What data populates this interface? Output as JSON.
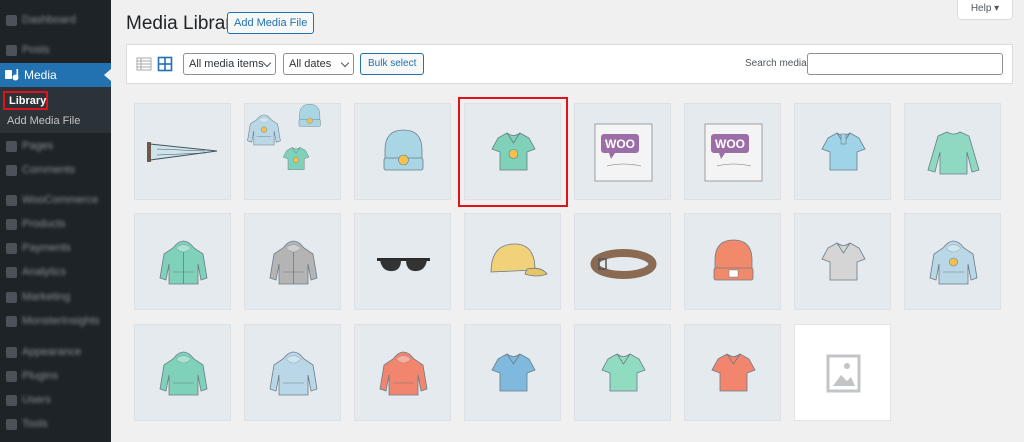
{
  "sidebar": {
    "items": [
      {
        "label": "Dashboard",
        "icon": "dashboard-icon"
      },
      {
        "label": "Posts",
        "icon": "posts-icon"
      },
      {
        "label": "Media",
        "icon": "media-icon",
        "active": true
      },
      {
        "label": "Pages",
        "icon": "pages-icon"
      },
      {
        "label": "Comments",
        "icon": "comments-icon"
      },
      {
        "label": "WooCommerce",
        "icon": "woocommerce-icon"
      },
      {
        "label": "Products",
        "icon": "products-icon"
      },
      {
        "label": "Payments",
        "icon": "payments-icon"
      },
      {
        "label": "Analytics",
        "icon": "analytics-icon"
      },
      {
        "label": "Marketing",
        "icon": "marketing-icon"
      },
      {
        "label": "MonsterInsights",
        "icon": "monsterinsights-icon"
      },
      {
        "label": "Appearance",
        "icon": "appearance-icon"
      },
      {
        "label": "Plugins",
        "icon": "plugins-icon"
      },
      {
        "label": "Users",
        "icon": "users-icon"
      },
      {
        "label": "Tools",
        "icon": "tools-icon"
      }
    ],
    "submenu": {
      "library": "Library",
      "add_new": "Add Media File"
    },
    "active_color": "#2271b1",
    "highlight_color": "#e1121c"
  },
  "header": {
    "title": "Media Library",
    "add_button": "Add Media File",
    "help": "Help ▾"
  },
  "toolbar": {
    "filter_type": "All media items",
    "filter_date": "All dates",
    "bulk_select": "Bulk select",
    "search_label": "Search media",
    "search_value": ""
  },
  "media": [
    {
      "type": "pennant"
    },
    {
      "type": "hoodie-set"
    },
    {
      "type": "beanie-logo"
    },
    {
      "type": "vneck-logo",
      "selected": true
    },
    {
      "type": "woo-single"
    },
    {
      "type": "woo-album"
    },
    {
      "type": "polo"
    },
    {
      "type": "longsleeve"
    },
    {
      "type": "hoodie-zip"
    },
    {
      "type": "hoodie-gray"
    },
    {
      "type": "sunglasses"
    },
    {
      "type": "cap"
    },
    {
      "type": "belt"
    },
    {
      "type": "beanie"
    },
    {
      "type": "tshirt-gray"
    },
    {
      "type": "hoodie-logo"
    },
    {
      "type": "hoodie-green"
    },
    {
      "type": "hoodie-blue"
    },
    {
      "type": "hoodie-red"
    },
    {
      "type": "vneck-blue"
    },
    {
      "type": "vneck-green"
    },
    {
      "type": "vneck-red"
    },
    {
      "type": "placeholder"
    }
  ]
}
